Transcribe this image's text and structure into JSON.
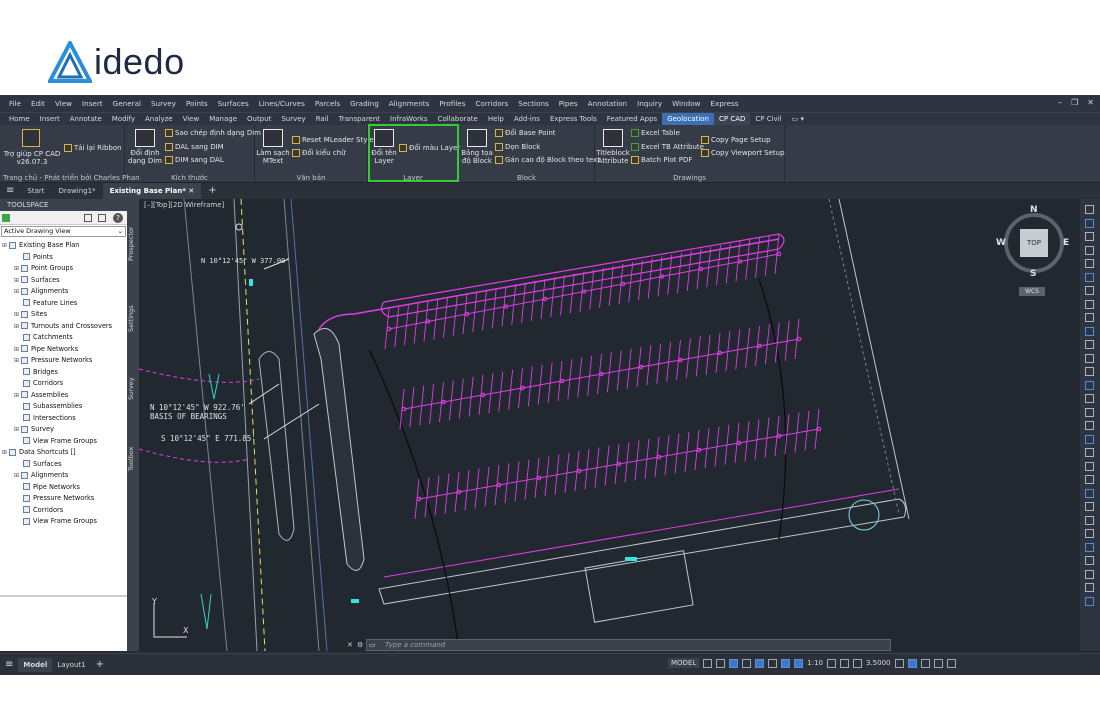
{
  "logo": {
    "text": "idedo"
  },
  "menubar": [
    "File",
    "Edit",
    "View",
    "Insert",
    "General",
    "Survey",
    "Points",
    "Surfaces",
    "Lines/Curves",
    "Parcels",
    "Grading",
    "Alignments",
    "Profiles",
    "Corridors",
    "Sections",
    "Pipes",
    "Annotation",
    "Inquiry",
    "Window",
    "Express"
  ],
  "window_controls": [
    "–",
    "❐",
    "✕"
  ],
  "ribbon_tabs": [
    "Home",
    "Insert",
    "Annotate",
    "Modify",
    "Analyze",
    "View",
    "Manage",
    "Output",
    "Survey",
    "Rail",
    "Transparent",
    "InfraWorks",
    "Collaborate",
    "Help",
    "Add-ins",
    "Express Tools",
    "Featured Apps",
    "Geolocation",
    "CP CAD",
    "CP Civil",
    "▭ ▾"
  ],
  "ribbon": {
    "help_btn": "Trợ giúp CP CAD",
    "version": "v26.07.3",
    "reload_btn": "Tải lại Ribbon",
    "panel1_title": "Trang chủ - Phát triển bởi Charles Phan",
    "dim_big": [
      "Đổi định",
      "dạng Dim"
    ],
    "copy_dim": "Sao chép định dạng Dim",
    "dal_dim": "DAL sang DIM",
    "dim_dal": "DIM sang DAL",
    "panel2_title": "Kích thước",
    "mtext_big": [
      "Làm sạch",
      "MText"
    ],
    "reset_mleader": "Reset MLeader Style",
    "text_style": "Đổi kiểu chữ",
    "panel3_title": "Văn bản",
    "layer_big": [
      "Đổi tên",
      "Layer"
    ],
    "layer_color": "Đổi màu Layer",
    "panel4_title": "Layer",
    "block_big": [
      "Bảng tọa",
      "độ Block"
    ],
    "base_point": "Đổi Base Point",
    "clean_block": "Dọn Block",
    "block_elev": "Gán cao độ Block theo text",
    "panel5_title": "Block",
    "title_big": [
      "Titleblock",
      "Attribute"
    ],
    "excel_table": "Excel Table",
    "excel_tb": "Excel TB Attribute",
    "batch_pdf": "Batch Plot PDF",
    "copy_page": "Copy Page Setup",
    "copy_view": "Copy Viewport Setup",
    "panel6_title": "Drawings"
  },
  "doc_tabs": [
    "Start",
    "Drawing1*",
    "Existing Base Plan*"
  ],
  "toolspace": {
    "title": "TOOLSPACE",
    "view": "Active Drawing View",
    "root": "Existing Base Plan",
    "items": [
      "Points",
      "Point Groups",
      "Surfaces",
      "Alignments",
      "Feature Lines",
      "Sites",
      "Turnouts and Crossovers",
      "Catchments",
      "Pipe Networks",
      "Pressure Networks",
      "Bridges",
      "Corridors",
      "Assemblies",
      "Subassemblies",
      "Intersections",
      "Survey",
      "View Frame Groups"
    ],
    "shortcuts": "Data Shortcuts []",
    "shortcut_items": [
      "Surfaces",
      "Alignments",
      "Pipe Networks",
      "Pressure Networks",
      "Corridors",
      "View Frame Groups"
    ],
    "sidetabs": [
      "Prospector",
      "Settings",
      "Survey",
      "Toolbox"
    ]
  },
  "viewport": {
    "label": "[–][Top][2D Wireframe]",
    "bearing1": "N 10°12'45\" W  377.00'",
    "bearing2": "N 10°12'45\" W  922.76'",
    "bearing3": "BASIS OF BEARINGS",
    "bearing4": "S 10°12'45\" E  771.85'",
    "compass": {
      "n": "N",
      "s": "S",
      "e": "E",
      "w": "W",
      "top": "TOP",
      "wcs": "WCS"
    },
    "axis_y": "Y",
    "axis_x": "X"
  },
  "command_placeholder": "Type a command",
  "status": {
    "tabs": [
      "Model",
      "Layout1"
    ],
    "model": "MODEL",
    "scale": "1:10",
    "value": "3.5000"
  },
  "colors": {
    "magenta": "#e13ce6",
    "highlight": "#33cc33",
    "accent": "#3d6fb4"
  }
}
